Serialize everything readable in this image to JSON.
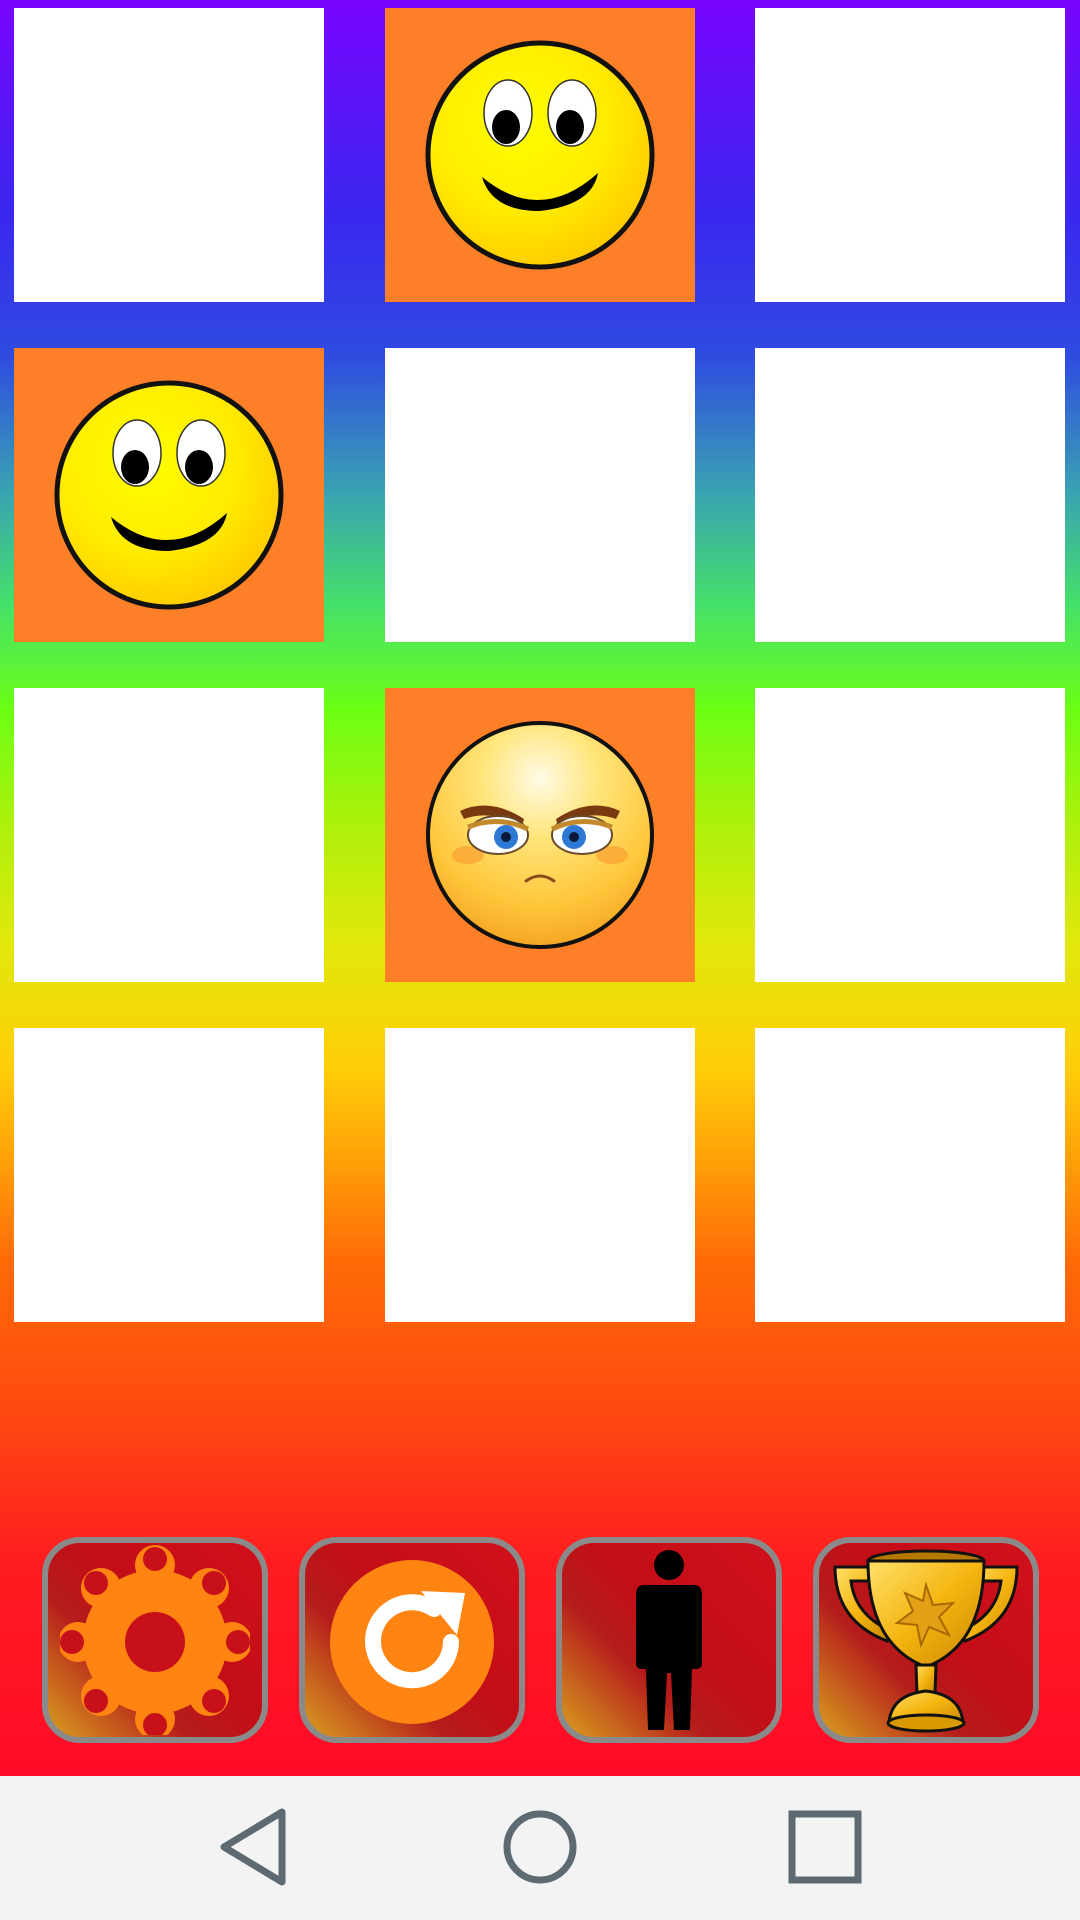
{
  "board": {
    "rows": 4,
    "cols": 3,
    "tiles": [
      {
        "state": "hidden"
      },
      {
        "state": "revealed",
        "face": "happy-smiley"
      },
      {
        "state": "hidden"
      },
      {
        "state": "revealed",
        "face": "happy-smiley"
      },
      {
        "state": "hidden"
      },
      {
        "state": "hidden"
      },
      {
        "state": "hidden"
      },
      {
        "state": "revealed",
        "face": "angry-face"
      },
      {
        "state": "hidden"
      },
      {
        "state": "hidden"
      },
      {
        "state": "hidden"
      },
      {
        "state": "hidden"
      }
    ]
  },
  "toolbar": {
    "buttons": [
      {
        "icon": "gear-icon",
        "action": "settings"
      },
      {
        "icon": "refresh-icon",
        "action": "restart"
      },
      {
        "icon": "person-icon",
        "action": "player"
      },
      {
        "icon": "trophy-icon",
        "action": "leaderboard"
      }
    ]
  },
  "navbar": {
    "buttons": [
      {
        "icon": "back-triangle-icon"
      },
      {
        "icon": "home-circle-icon"
      },
      {
        "icon": "recents-square-icon"
      }
    ]
  },
  "colors": {
    "tile_hidden": "#ffffff",
    "tile_revealed": "#fd7f27",
    "button_border": "#8a8a8a",
    "navbar_bg": "#f3f3f3",
    "nav_icon": "#5d6a72"
  }
}
